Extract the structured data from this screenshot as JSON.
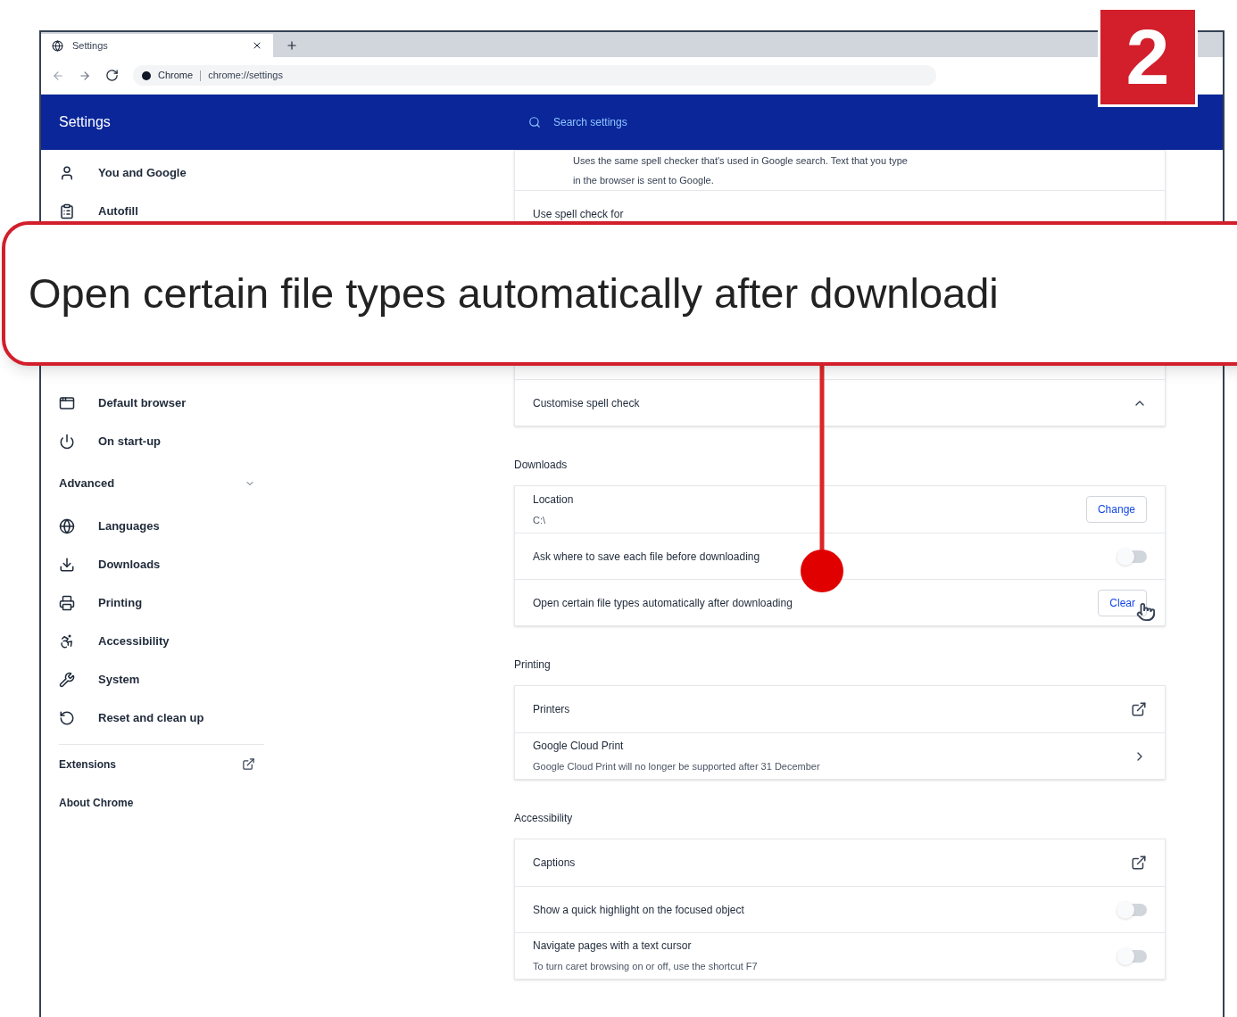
{
  "browser": {
    "tab": {
      "title": "Settings"
    },
    "address": {
      "site": "Chrome",
      "url": "chrome://settings"
    }
  },
  "header": {
    "title": "Settings",
    "search": {
      "placeholder": "Search settings"
    }
  },
  "sidebar": {
    "items_above": [
      {
        "label": "You and Google"
      },
      {
        "label": "Autofill"
      }
    ],
    "items_below": [
      {
        "label": "Default browser"
      },
      {
        "label": "On start-up"
      }
    ],
    "advanced": {
      "label": "Advanced",
      "expanded": true,
      "items": [
        {
          "label": "Languages"
        },
        {
          "label": "Downloads"
        },
        {
          "label": "Printing"
        },
        {
          "label": "Accessibility"
        },
        {
          "label": "System"
        },
        {
          "label": "Reset and clean up"
        }
      ]
    },
    "links": [
      {
        "label": "Extensions",
        "kind": "external"
      },
      {
        "label": "About Chrome",
        "kind": "plain"
      }
    ]
  },
  "sections": [
    {
      "rows": [
        {
          "kind": "text",
          "lines": [
            "Uses the same spell checker that's used in Google search. Text that you type",
            "in the browser is sent to Google."
          ]
        },
        {
          "kind": "plain",
          "label": "Use spell check for"
        }
      ],
      "rows_below_callout": [
        {
          "kind": "expand",
          "label": "Customise spell check",
          "expanded": true
        }
      ]
    },
    {
      "heading": "Downloads",
      "rows": [
        {
          "kind": "button",
          "label": "Location",
          "sub": "C:\\",
          "button": "Change"
        },
        {
          "kind": "toggle",
          "label": "Ask where to save each file before downloading",
          "on": false
        },
        {
          "kind": "button",
          "label": "Open certain file types automatically after downloading",
          "button": "Clear",
          "pointer": true
        }
      ]
    },
    {
      "heading": "Printing",
      "rows": [
        {
          "kind": "external",
          "label": "Printers"
        },
        {
          "kind": "arrow",
          "label": "Google Cloud Print",
          "sub": "Google Cloud Print will no longer be supported after 31 December"
        }
      ]
    },
    {
      "heading": "Accessibility",
      "rows": [
        {
          "kind": "external",
          "label": "Captions"
        },
        {
          "kind": "toggle",
          "label": "Show a quick highlight on the focused object",
          "on": false
        },
        {
          "kind": "toggle",
          "label": "Navigate pages with a text cursor",
          "sub": "To turn caret browsing on or off, use the shortcut F7",
          "on": false
        }
      ]
    }
  ],
  "callout": {
    "text": "Open certain file types automatically after downloadi"
  },
  "step_badge": {
    "text": "2"
  }
}
